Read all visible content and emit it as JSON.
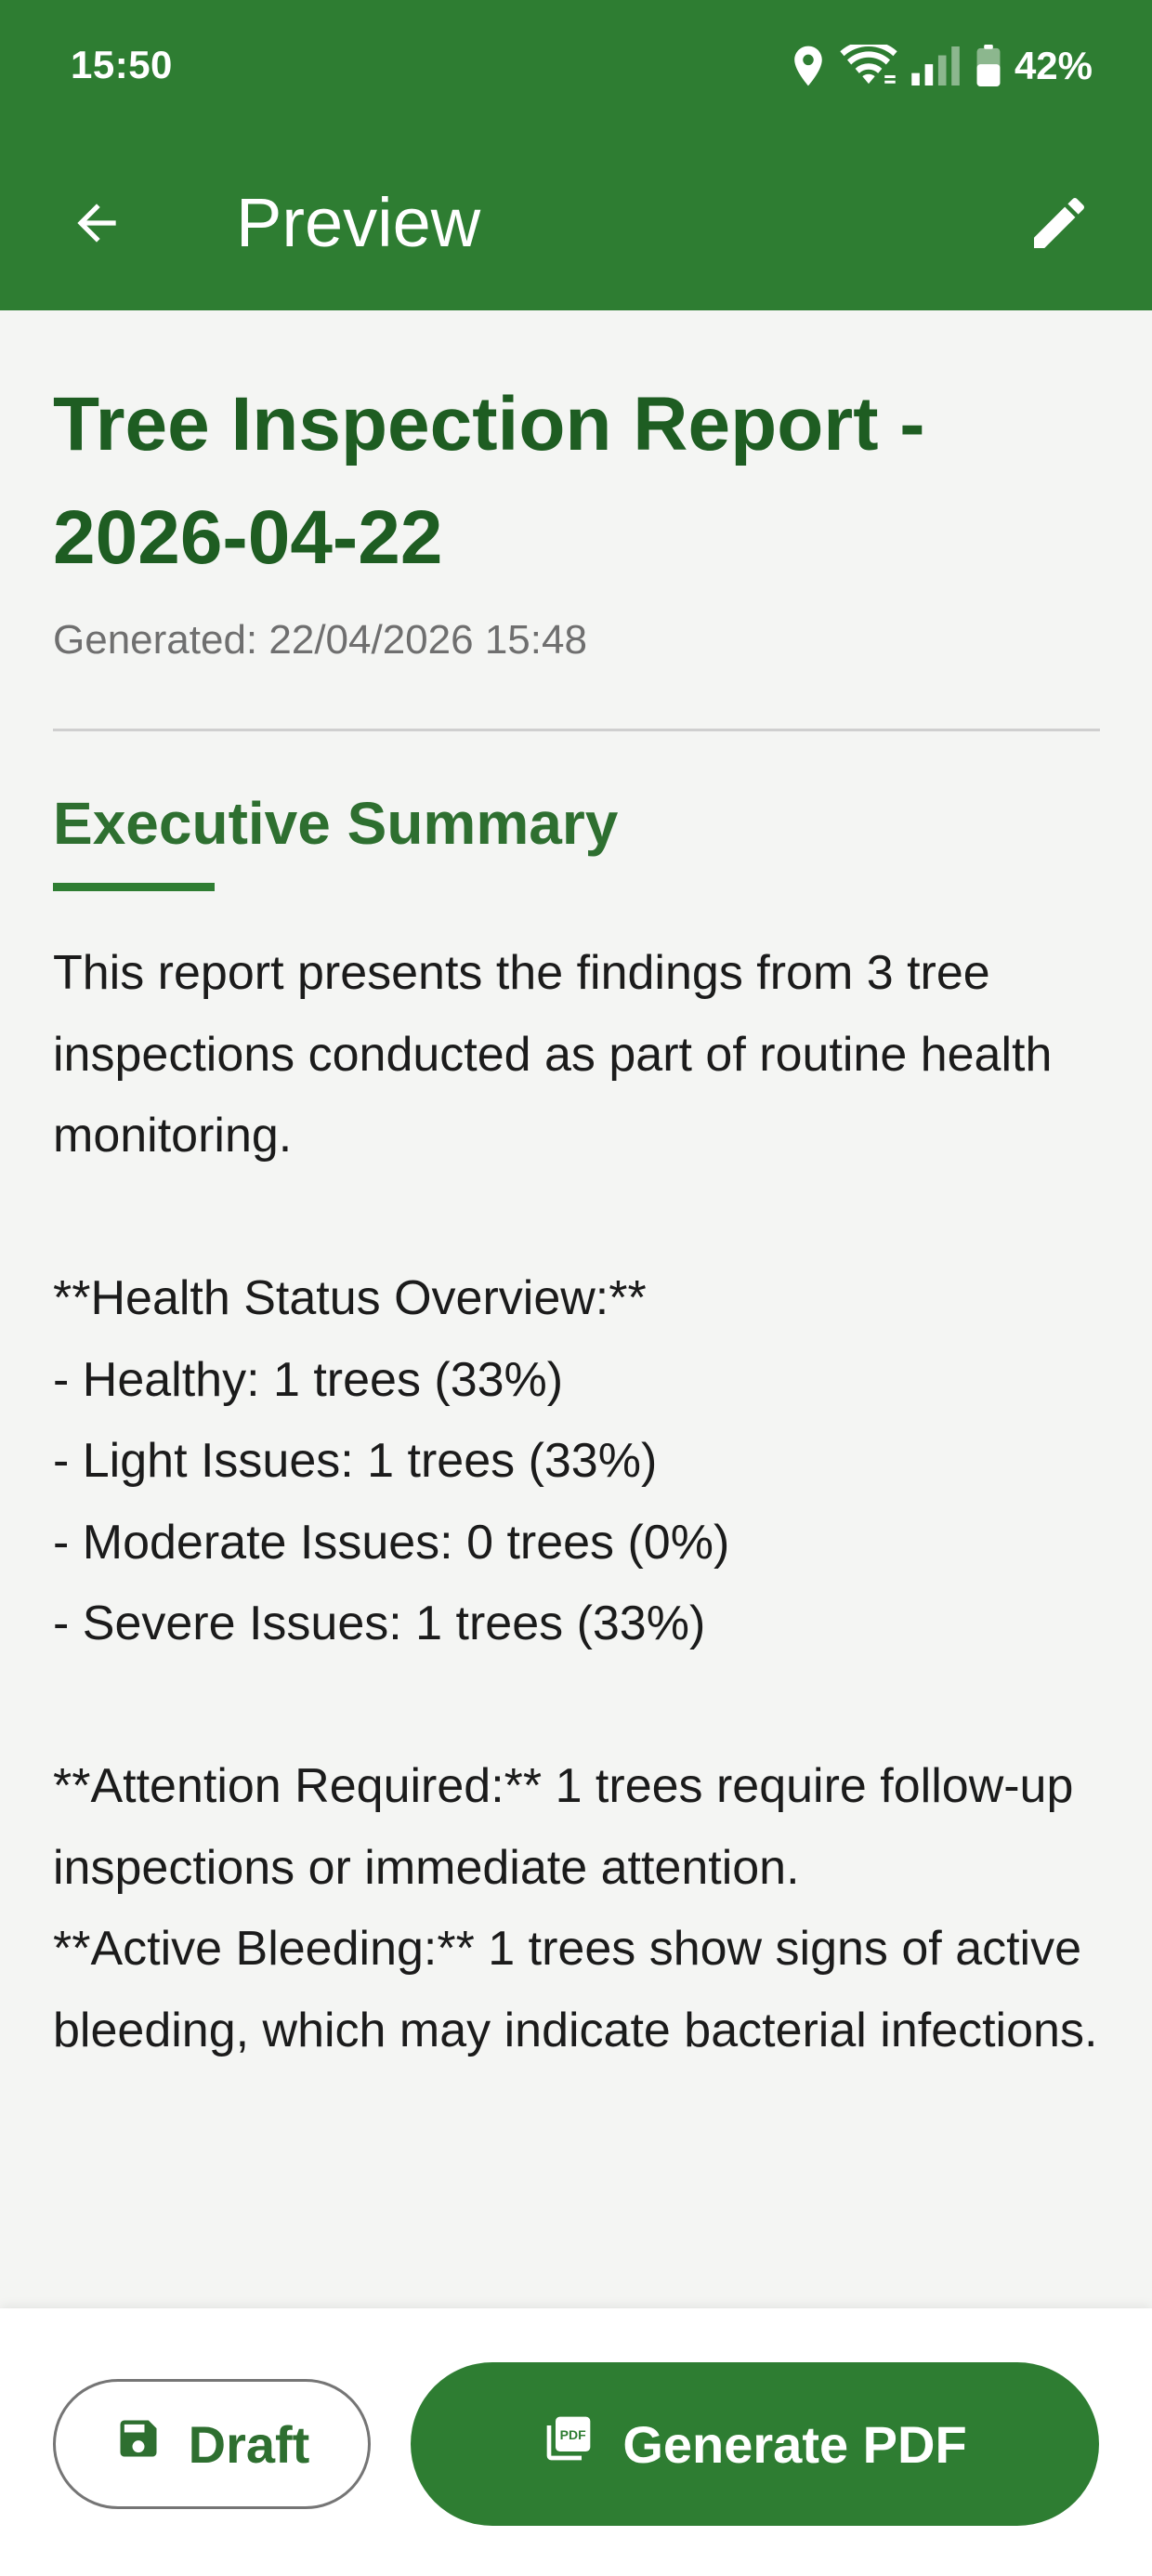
{
  "status_bar": {
    "time": "15:50",
    "battery": "42%",
    "icons": [
      "location-icon",
      "wifi-icon",
      "signal-icon",
      "battery-icon"
    ]
  },
  "app_bar": {
    "title": "Preview",
    "back_icon": "arrow-back-icon",
    "edit_icon": "pencil-edit-icon",
    "background_color": "#2e7d32"
  },
  "report": {
    "title": "Tree Inspection Report - 2026-04-22",
    "generated": "Generated: 22/04/2026 15:48",
    "section_heading": "Executive Summary",
    "summary": "This report presents the findings from 3 tree inspections conducted as part of routine health monitoring.\n\n**Health Status Overview:**\n- Healthy: 1 trees (33%)\n- Light Issues: 1 trees (33%)\n- Moderate Issues: 0 trees (0%)\n- Severe Issues: 1 trees (33%)\n\n**Attention Required:** 1 trees require follow-up inspections or immediate attention.\n**Active Bleeding:** 1 trees show signs of active bleeding, which may indicate bacterial infections."
  },
  "actions": {
    "draft_label": "Draft",
    "draft_icon": "save-icon",
    "pdf_label": "Generate PDF",
    "pdf_icon": "pdf-file-icon"
  },
  "colors": {
    "primary": "#2e7d32",
    "heading": "#1e5d22",
    "background": "#f4f5f3"
  }
}
